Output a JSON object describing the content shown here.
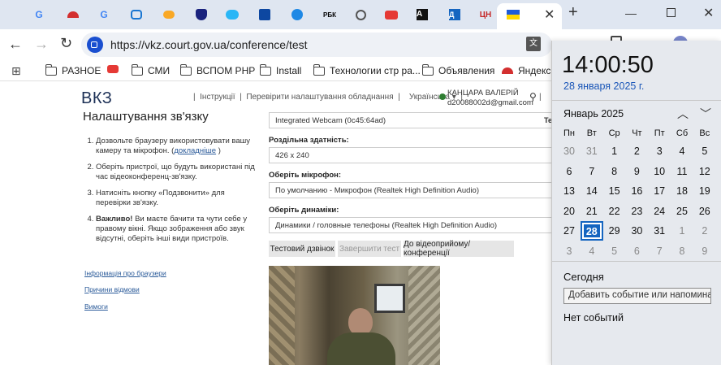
{
  "browser": {
    "url": "https://vkz.court.gov.ua/conference/test",
    "bookmarks": [
      "РАЗНОЕ",
      "СМИ",
      "ВСПОМ РНР",
      "Install",
      "Технологии стр ра...",
      "Объявления",
      "Яндекс.П"
    ]
  },
  "header": {
    "logo": "ВКЗ",
    "nav": [
      "Інструкції",
      "Перевірити налаштування обладнання"
    ],
    "language": "Українська",
    "user_name": "КАНЦАРА ВАЛЕРІЙ",
    "user_email": "d20088002d@gmail.com",
    "partial_right": "Те"
  },
  "left": {
    "title": "Налаштування зв'язку",
    "steps": [
      {
        "text": "Дозвольте браузеру використовувати вашу камеру та мікрофон. (",
        "link": "докладніше",
        "after": " )"
      },
      {
        "text": "Оберіть пристрої, що будуть використані під час відеоконференц-зв'язку."
      },
      {
        "text": "Натисніть кнопку «Подзвонити» для перевірки зв'язку."
      },
      {
        "bold": "Важливо!",
        "text": " Ви маєте бачити та чути себе у правому вікні. Якщо зображення або звук відсутні, оберіть інші види пристроїв."
      }
    ],
    "links": [
      "Інформація про браузери",
      "Причини відмови",
      "Вимоги"
    ]
  },
  "form": {
    "camera_value": "Integrated Webcam (0c45:64ad)",
    "resolution_label": "Роздільна здатність:",
    "resolution_value": "426 x 240",
    "mic_label": "Оберіть мікрофон:",
    "mic_value": "По умолчанию - Микрофон (Realtek High Definition Audio)",
    "speaker_label": "Оберіть динаміки:",
    "speaker_value": "Динамики / головные телефоны (Realtek High Definition Audio)",
    "buttons": [
      "Тестовий дзвінок",
      "Завершити тест",
      "До відеоприйому/конференції"
    ]
  },
  "calendar": {
    "time": "14:00:50",
    "date": "28 января 2025 г.",
    "month": "Январь 2025",
    "weekdays": [
      "Пн",
      "Вт",
      "Ср",
      "Чт",
      "Пт",
      "Сб",
      "Вс"
    ],
    "weeks": [
      [
        "30",
        "31",
        "1",
        "2",
        "3",
        "4",
        "5"
      ],
      [
        "6",
        "7",
        "8",
        "9",
        "10",
        "11",
        "12"
      ],
      [
        "13",
        "14",
        "15",
        "16",
        "17",
        "18",
        "19"
      ],
      [
        "20",
        "21",
        "22",
        "23",
        "24",
        "25",
        "26"
      ],
      [
        "27",
        "28",
        "29",
        "30",
        "31",
        "1",
        "2"
      ],
      [
        "3",
        "4",
        "5",
        "6",
        "7",
        "8",
        "9"
      ]
    ],
    "today_label": "Сегодня",
    "add_event_placeholder": "Добавить событие или напомина",
    "no_events": "Нет событий",
    "accent": "#1565c0"
  }
}
